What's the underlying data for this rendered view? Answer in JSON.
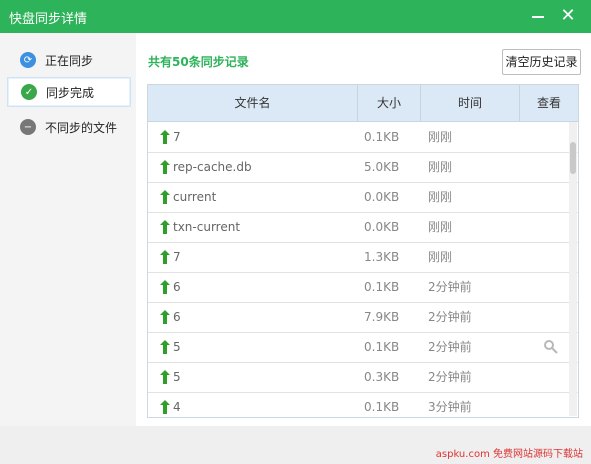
{
  "window": {
    "title": "快盘同步详情"
  },
  "sidebar": {
    "items": [
      {
        "label": "正在同步",
        "icon": "sync-icon"
      },
      {
        "label": "同步完成",
        "icon": "check-icon"
      },
      {
        "label": "不同步的文件",
        "icon": "minus-icon"
      }
    ]
  },
  "summary": {
    "text": "共有50条同步记录"
  },
  "actions": {
    "clear_history": "清空历史记录"
  },
  "table": {
    "headers": [
      "文件名",
      "大小",
      "时间",
      "查看"
    ],
    "rows": [
      {
        "name": "7",
        "size": "0.1KB",
        "time": "刚刚"
      },
      {
        "name": "rep-cache.db",
        "size": "5.0KB",
        "time": "刚刚"
      },
      {
        "name": "current",
        "size": "0.0KB",
        "time": "刚刚"
      },
      {
        "name": "txn-current",
        "size": "0.0KB",
        "time": "刚刚"
      },
      {
        "name": "7",
        "size": "1.3KB",
        "time": "刚刚"
      },
      {
        "name": "6",
        "size": "0.1KB",
        "time": "2分钟前"
      },
      {
        "name": "6",
        "size": "7.9KB",
        "time": "2分钟前"
      },
      {
        "name": "5",
        "size": "0.1KB",
        "time": "2分钟前"
      },
      {
        "name": "5",
        "size": "0.3KB",
        "time": "2分钟前"
      },
      {
        "name": "4",
        "size": "0.1KB",
        "time": "3分钟前"
      }
    ]
  },
  "watermark": "aspku.com 免费网站源码下载站"
}
